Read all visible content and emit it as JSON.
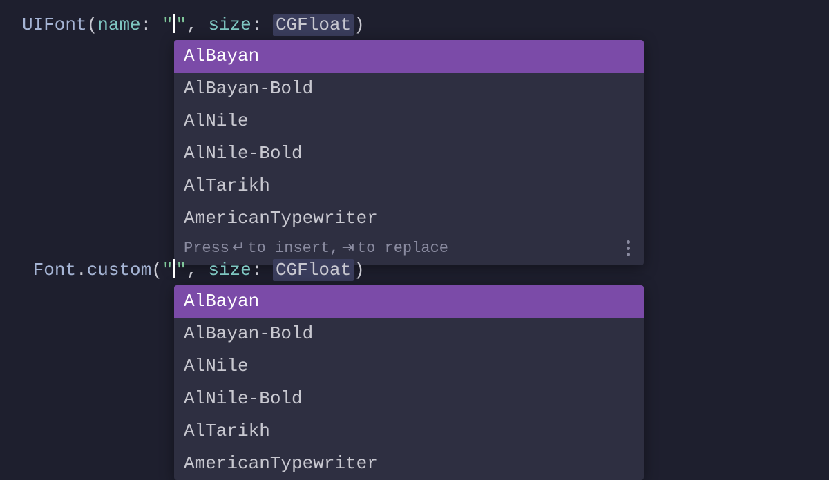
{
  "line1": {
    "type": "UIFont",
    "openParen": "(",
    "paramName": "name",
    "colon1": ":",
    "quote1": "\"",
    "quote2": "\"",
    "comma": ",",
    "paramSize": "size",
    "colon2": ":",
    "typeHint": "CGFloat",
    "closeParen": ")"
  },
  "line2": {
    "type": "Font",
    "dot": ".",
    "method": "custom",
    "openParen": "(",
    "quote1": "\"",
    "quote2": "\"",
    "comma": ",",
    "paramSize": "size",
    "colon2": ":",
    "typeHint": "CGFloat",
    "closeParen": ")"
  },
  "autocomplete1": {
    "items": [
      "AlBayan",
      "AlBayan-Bold",
      "AlNile",
      "AlNile-Bold",
      "AlTarikh",
      "AmericanTypewriter"
    ],
    "footer": {
      "press": "Press",
      "enterSymbol": "↵",
      "insertText": "to insert,",
      "tabSymbol": "⇥",
      "replaceText": "to replace"
    }
  },
  "autocomplete2": {
    "items": [
      "AlBayan",
      "AlBayan-Bold",
      "AlNile",
      "AlNile-Bold",
      "AlTarikh",
      "AmericanTypewriter"
    ]
  }
}
